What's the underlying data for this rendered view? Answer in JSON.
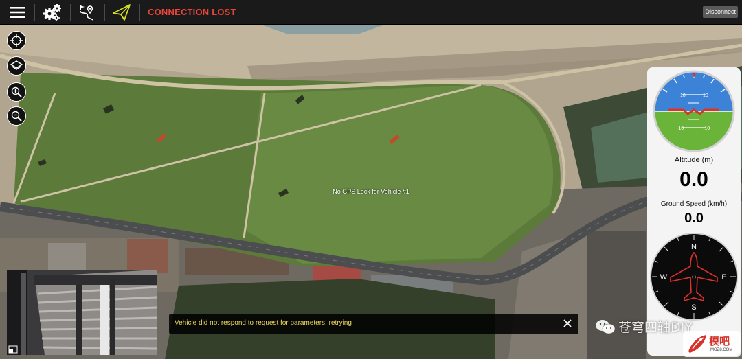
{
  "toolbar": {
    "menu_icon": "hamburger-menu-icon",
    "settings_icon": "gears-icon",
    "plan_icon": "waypoint-route-icon",
    "fly_icon": "paper-plane-icon",
    "connection_status": "CONNECTION LOST",
    "disconnect_label": "Disconnect"
  },
  "map": {
    "message": "No GPS Lock for Vehicle #1",
    "controls": [
      "center-vehicle-icon",
      "layers-icon",
      "zoom-in-icon",
      "zoom-out-icon"
    ]
  },
  "notification": {
    "text": "Vehicle did not respond to request for parameters, retrying",
    "close_label": "×"
  },
  "instruments": {
    "attitude": {
      "pitch_labels_upper": [
        "10",
        "10"
      ],
      "pitch_labels_lower": [
        "-10",
        "-10"
      ]
    },
    "altitude_label": "Altitude (m)",
    "altitude_value": "0.0",
    "ground_speed_label": "Ground Speed (km/h)",
    "ground_speed_value": "0.0",
    "compass": {
      "north": "N",
      "south": "S",
      "east": "E",
      "west": "W",
      "heading": "0"
    }
  },
  "watermark": {
    "text": "苍穹四轴DIY",
    "logo_text": "模吧",
    "logo_sub": "MOZ8.COM"
  },
  "colors": {
    "status_red": "#e8443a",
    "notification_text": "#f2d860",
    "sky": "#3c83d8",
    "ground": "#6ab43a",
    "compass_red": "#e0302a"
  }
}
